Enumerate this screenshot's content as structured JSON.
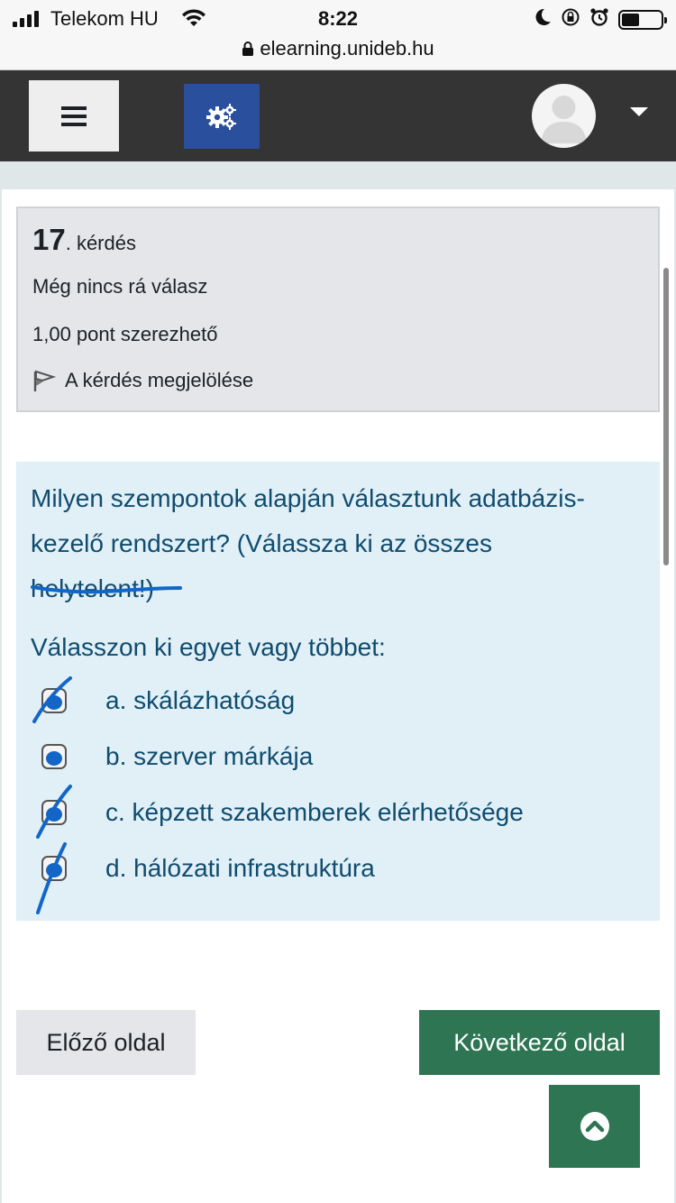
{
  "status_bar": {
    "carrier": "Telekom HU",
    "time": "8:22",
    "url": "elearning.unideb.hu",
    "battery_level": 0.45
  },
  "navbar": {
    "menu_icon": "hamburger-icon",
    "blocks_icon": "gears-icon",
    "user_icon": "avatar-icon",
    "dropdown_icon": "caret-down-icon"
  },
  "question_info": {
    "number": "17",
    "number_suffix": ". kérdés",
    "state": "Még nincs rá válasz",
    "grade": "1,00 pont szerezhető",
    "flag_label": "A kérdés megjelölése"
  },
  "question": {
    "text_line1": "Milyen szempontok alapján választunk adatbázis-",
    "text_line2": "kezelő rendszert? (Válassza ki az összes",
    "text_line3": "helytelent!)",
    "prompt": "Válasszon ki egyet vagy többet:",
    "options": [
      {
        "label": "a. skálázhatóság",
        "marked": true,
        "struck": true
      },
      {
        "label": "b. szerver márkája",
        "marked": true,
        "struck": false
      },
      {
        "label": "c. képzett szakemberek elérhetősége",
        "marked": true,
        "struck": true
      },
      {
        "label": "d. hálózati infrastruktúra",
        "marked": true,
        "struck": true
      }
    ]
  },
  "navigation": {
    "prev_label": "Előző oldal",
    "next_label": "Következő oldal",
    "top_icon": "chevron-up-icon"
  },
  "colors": {
    "navbar": "#343434",
    "blocks_button": "#2a4f9c",
    "question_bg": "#e1eff7",
    "question_text": "#0f4c6e",
    "info_bg": "#e4e6e9",
    "primary_button": "#2e7553",
    "annotation_ink": "#1266c7"
  }
}
